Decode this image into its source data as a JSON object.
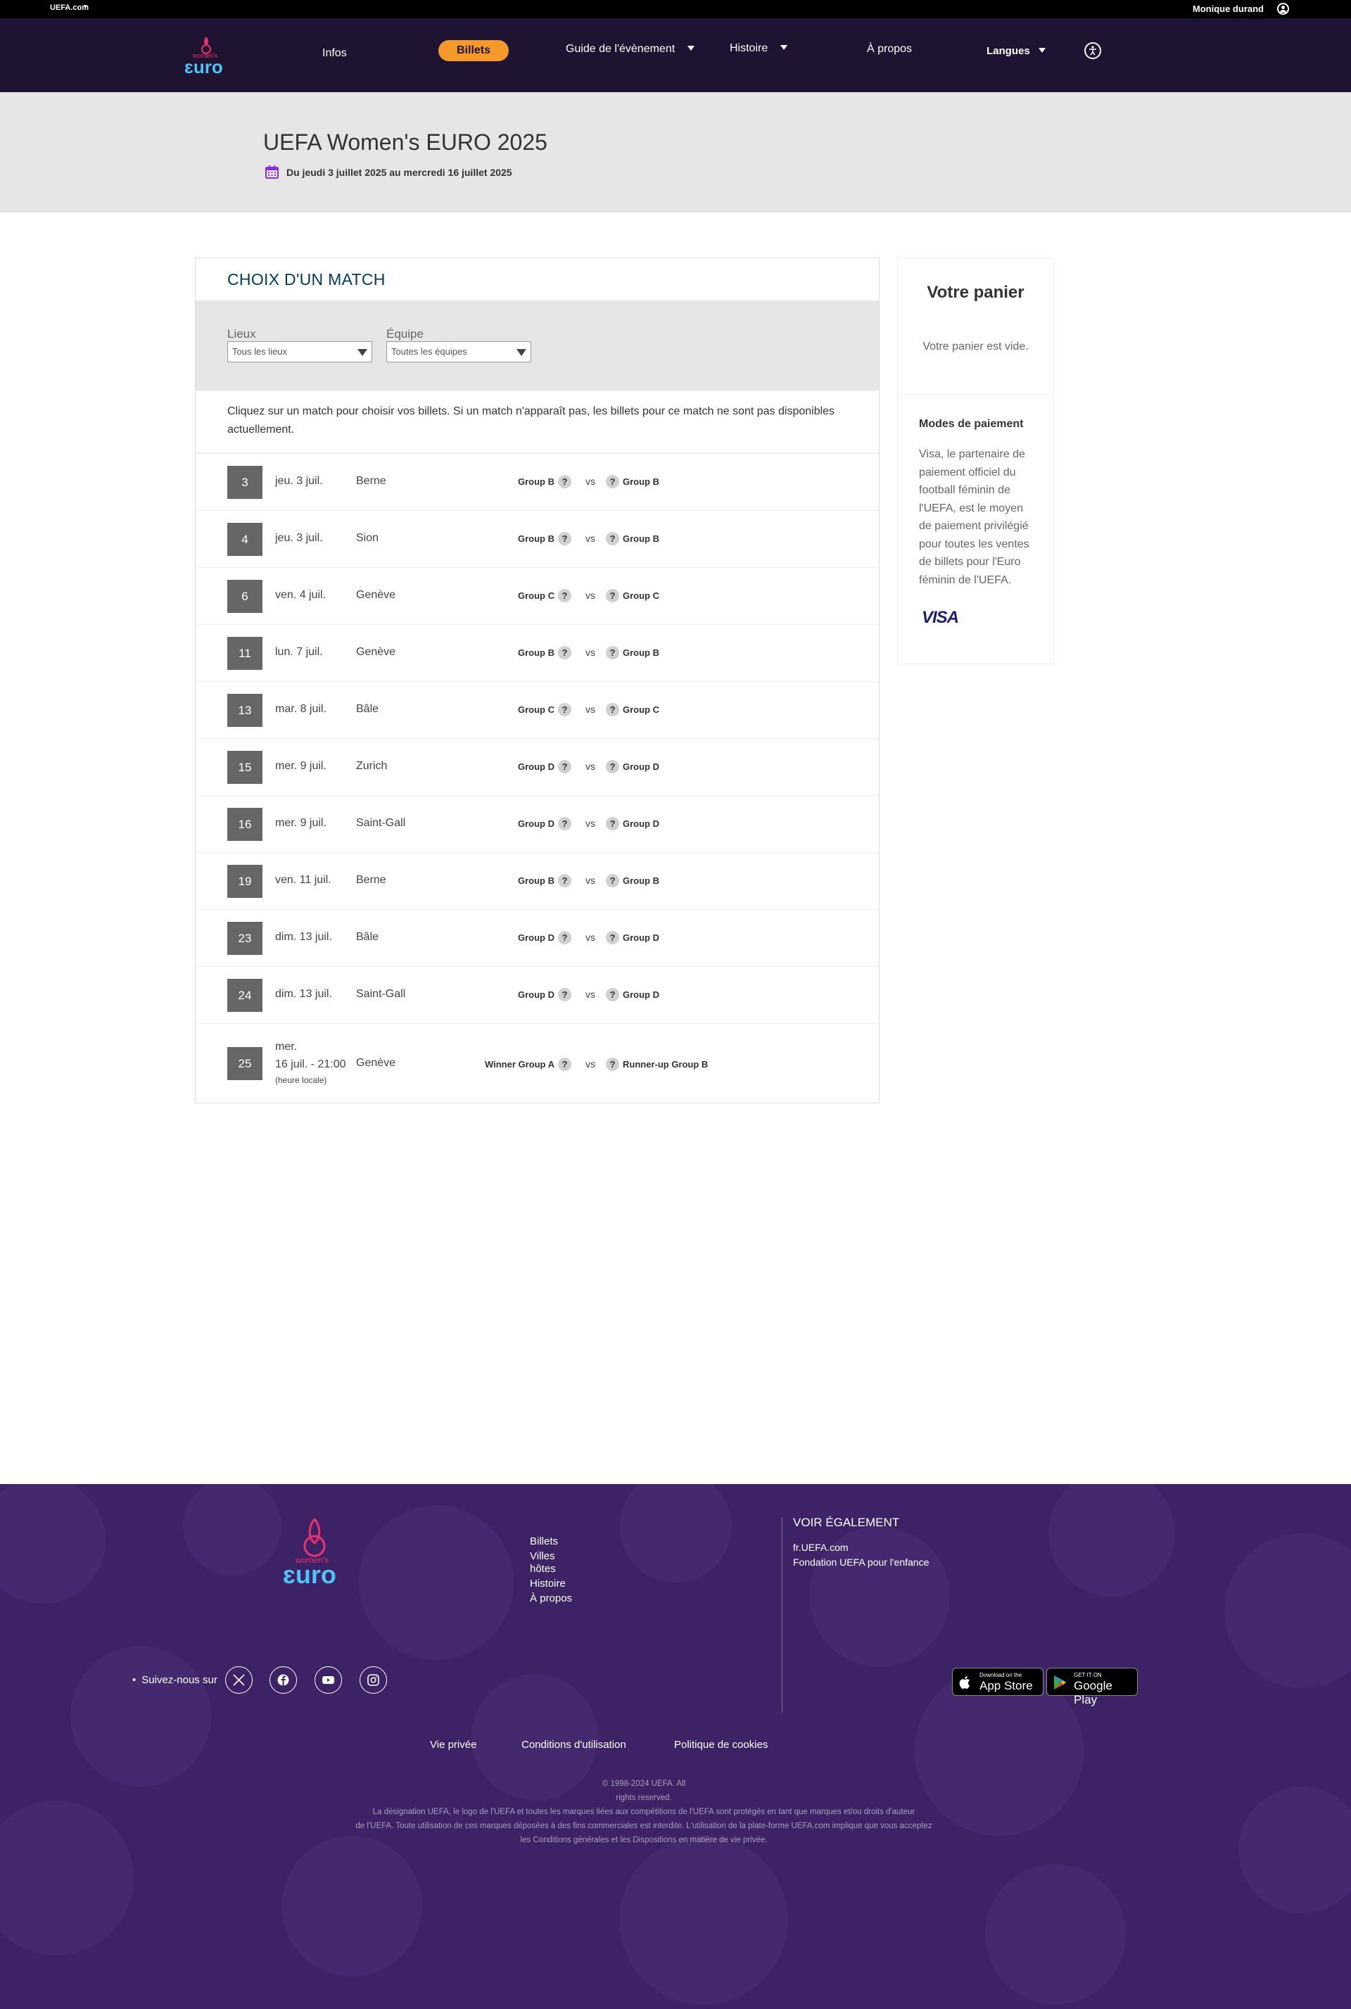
{
  "topbar": {
    "brand": "UEFA.com",
    "brand_caret": "▾",
    "user_name": "Monique durand"
  },
  "nav": {
    "items": [
      {
        "label": "Infos"
      },
      {
        "label": "Billets"
      },
      {
        "label": "Guide de l'évènement"
      },
      {
        "label": "Histoire"
      },
      {
        "label": "À propos"
      },
      {
        "label": "Langues"
      }
    ]
  },
  "hero": {
    "title": "UEFA Women's EURO 2025",
    "dates": "Du jeudi 3 juillet 2025 au mercredi 16 juillet 2025"
  },
  "card": {
    "title": "CHOIX D'UN MATCH",
    "filters": {
      "venue_label": "Lieux",
      "venue_value": "Tous les lieux",
      "team_label": "Équipe",
      "team_value": "Toutes les équipes"
    },
    "intro": "Cliquez sur un match pour choisir vos billets. Si un match n'apparaît pas, les billets pour ce match ne sont pas disponibles actuellement.",
    "vs_label": "vs",
    "unknown_glyph": "?",
    "matches": [
      {
        "num": "3",
        "date": "jeu. 3 juil.",
        "city": "Berne",
        "home": "Group B",
        "away": "Group B"
      },
      {
        "num": "4",
        "date": "jeu. 3 juil.",
        "city": "Sion",
        "home": "Group B",
        "away": "Group B"
      },
      {
        "num": "6",
        "date": "ven. 4 juil.",
        "city": "Genève",
        "home": "Group C",
        "away": "Group C"
      },
      {
        "num": "11",
        "date": "lun. 7 juil.",
        "city": "Genève",
        "home": "Group B",
        "away": "Group B"
      },
      {
        "num": "13",
        "date": "mar. 8 juil.",
        "city": "Bâle",
        "home": "Group C",
        "away": "Group C"
      },
      {
        "num": "15",
        "date": "mer. 9 juil.",
        "city": "Zurich",
        "home": "Group D",
        "away": "Group D"
      },
      {
        "num": "16",
        "date": "mer. 9 juil.",
        "city": "Saint-Gall",
        "home": "Group D",
        "away": "Group D"
      },
      {
        "num": "19",
        "date": "ven. 11 juil.",
        "city": "Berne",
        "home": "Group B",
        "away": "Group B"
      },
      {
        "num": "23",
        "date": "dim. 13 juil.",
        "city": "Bâle",
        "home": "Group D",
        "away": "Group D"
      },
      {
        "num": "24",
        "date": "dim. 13 juil.",
        "city": "Saint-Gall",
        "home": "Group D",
        "away": "Group D"
      }
    ],
    "final_match": {
      "num": "25",
      "date_line1": "mer.",
      "date_line2": "16 juil. - 21:00",
      "local_time": "(heure locale)",
      "city": "Genève",
      "home": "Winner Group A",
      "away": "Runner-up Group B"
    }
  },
  "cart": {
    "title": "Votre panier",
    "empty": "Votre panier est vide.",
    "payment_title": "Modes de paiement",
    "payment_text": "Visa, le partenaire de paiement officiel du football féminin de l'UEFA, est le moyen de paiement privilégié pour toutes les ventes de billets pour l'Euro féminin de l'UEFA.",
    "visa_logo": "VISA"
  },
  "footer": {
    "links": [
      "Billets",
      "Villes hôtes",
      "Histoire",
      "À propos"
    ],
    "see_also_title": "VOIR ÉGALEMENT",
    "see_also_links": [
      "fr.UEFA.com",
      "Fondation UEFA pour l'enfance"
    ],
    "follow": "Suivez-nous sur",
    "bullet": "•",
    "app_store_small": "Download on the",
    "app_store_big": "App Store",
    "google_small": "GET IT ON",
    "google_big": "Google Play",
    "legal_links": [
      "Vie privée",
      "Conditions d'utilisation",
      "Politique de cookies"
    ],
    "copyright_1": "© 1998-2024 UEFA. All rights reserved.",
    "copyright_2": "La désignation UEFA, le logo de l'UEFA et toutes les marques liées aux compétitions de l'UEFA sont protégés en tant que marques et/ou droits d'auteur",
    "copyright_3": "de l'UEFA. Toute utilisation de ces marques déposées à des fins commerciales est interdite. L'utilisation de la plate-forme UEFA.com implique que vous acceptez les Conditions générales et les Dispositions en matière de vie privée."
  },
  "colors": {
    "nav_bg": "#1e1330",
    "accent": "#f59a2a",
    "footer_bg": "#3d2266",
    "title_blue": "#003a55",
    "calendar_purple": "#8a2be2"
  }
}
